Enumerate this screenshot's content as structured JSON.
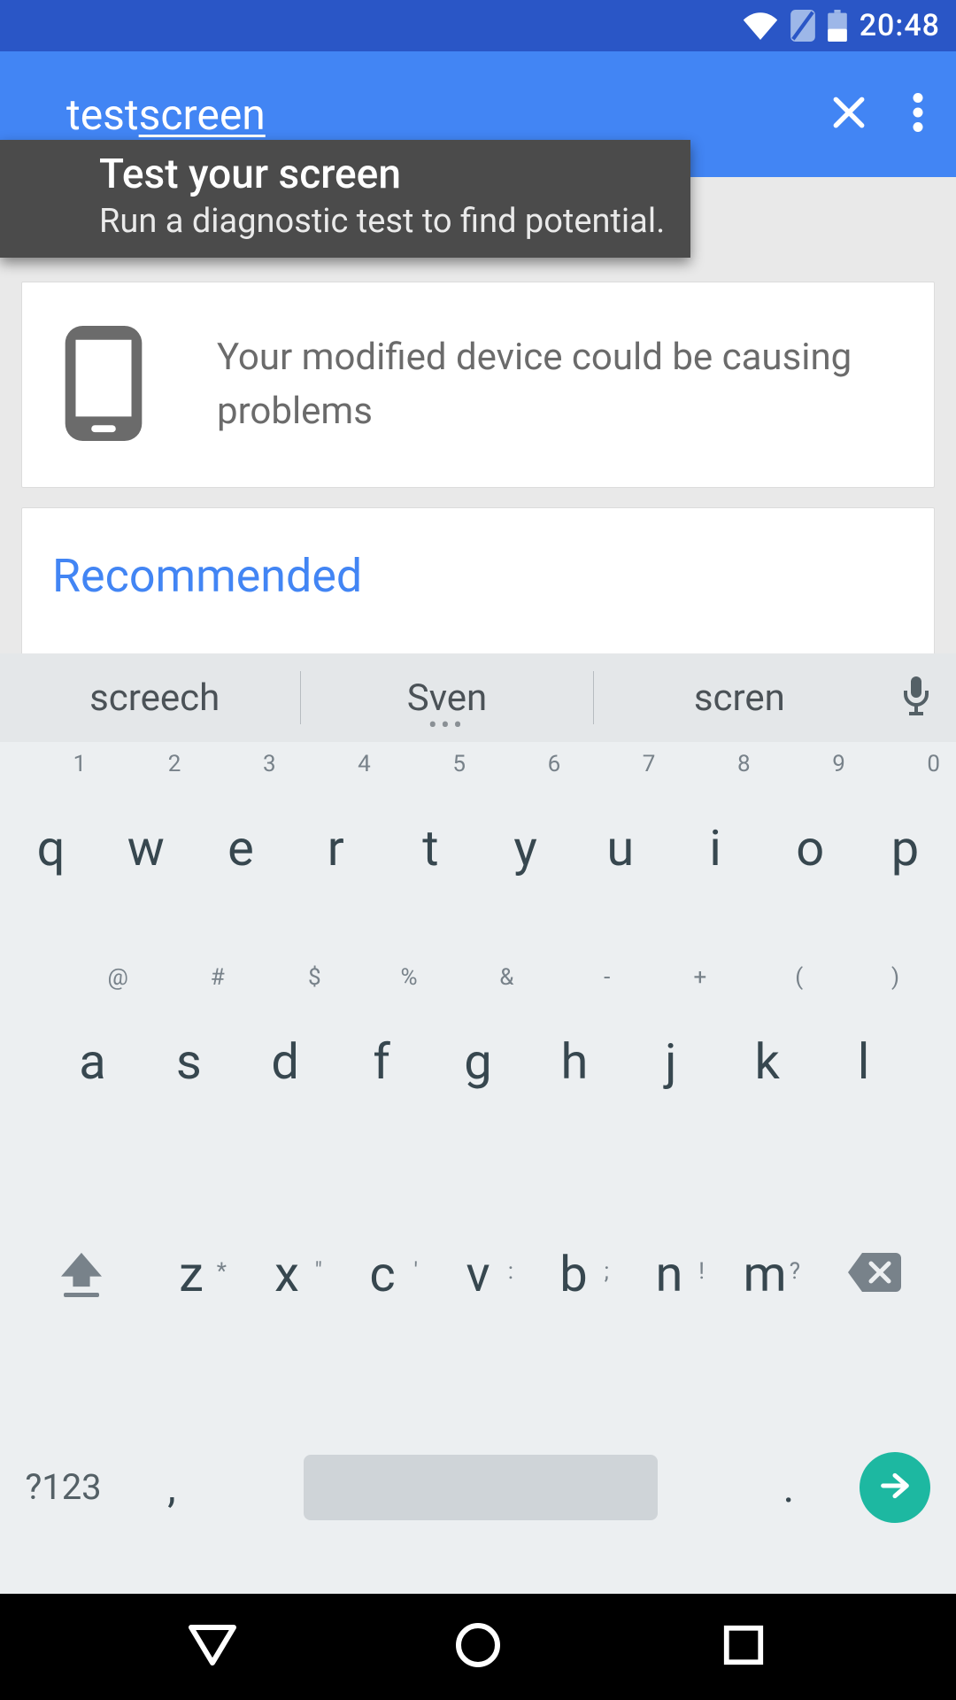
{
  "status": {
    "clock": "20:48"
  },
  "search": {
    "word1": "test ",
    "word2": "screen"
  },
  "dropdown": {
    "title": "Test your screen",
    "subtitle": "Run a diagnostic test to find potential…"
  },
  "cards": {
    "device_text": "Your modified device could be causing problems",
    "recommended_title": "Recommended"
  },
  "keyboard": {
    "suggestions": [
      "screech",
      "Sven",
      "scren"
    ],
    "row1": [
      {
        "main": "q",
        "hint": "1"
      },
      {
        "main": "w",
        "hint": "2"
      },
      {
        "main": "e",
        "hint": "3"
      },
      {
        "main": "r",
        "hint": "4"
      },
      {
        "main": "t",
        "hint": "5"
      },
      {
        "main": "y",
        "hint": "6"
      },
      {
        "main": "u",
        "hint": "7"
      },
      {
        "main": "i",
        "hint": "8"
      },
      {
        "main": "o",
        "hint": "9"
      },
      {
        "main": "p",
        "hint": "0"
      }
    ],
    "row2": [
      {
        "main": "a",
        "hint": "@"
      },
      {
        "main": "s",
        "hint": "#"
      },
      {
        "main": "d",
        "hint": "$"
      },
      {
        "main": "f",
        "hint": "%"
      },
      {
        "main": "g",
        "hint": "&"
      },
      {
        "main": "h",
        "hint": "-"
      },
      {
        "main": "j",
        "hint": "+"
      },
      {
        "main": "k",
        "hint": "("
      },
      {
        "main": "l",
        "hint": ")"
      }
    ],
    "row3": [
      {
        "main": "z",
        "hint": "*"
      },
      {
        "main": "x",
        "hint": "\""
      },
      {
        "main": "c",
        "hint": "'"
      },
      {
        "main": "v",
        "hint": ":"
      },
      {
        "main": "b",
        "hint": ";"
      },
      {
        "main": "n",
        "hint": "!"
      },
      {
        "main": "m",
        "hint": "?"
      }
    ],
    "sym": "?123",
    "comma": ",",
    "dot": "."
  }
}
